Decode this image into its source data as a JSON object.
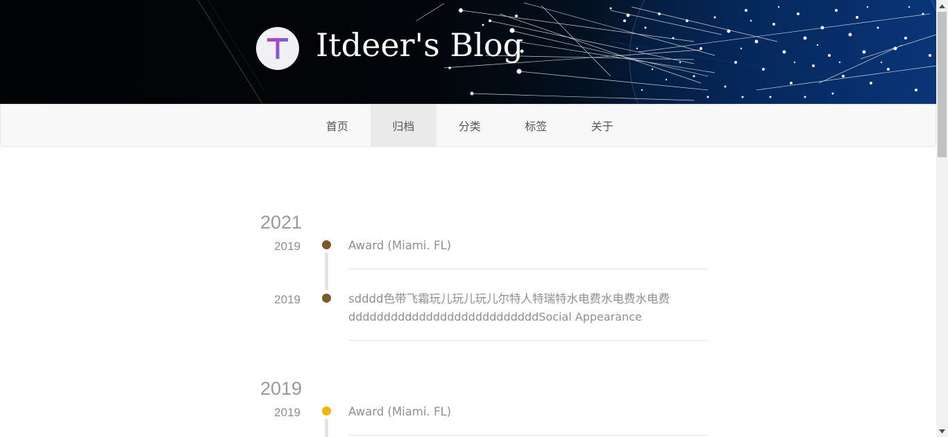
{
  "header": {
    "site_title": "Itdeer's Blog",
    "avatar_letter": "T"
  },
  "nav": {
    "items": [
      {
        "label": "首页",
        "active": false
      },
      {
        "label": "归档",
        "active": true
      },
      {
        "label": "分类",
        "active": false
      },
      {
        "label": "标签",
        "active": false
      },
      {
        "label": "关于",
        "active": false
      }
    ]
  },
  "archive": {
    "groups": [
      {
        "year": "2021",
        "posts": [
          {
            "date": "2019",
            "title": "Award (Miami. FL)",
            "dot_color": "#7d5928"
          },
          {
            "date": "2019",
            "title": "sdddd色带飞霜玩儿玩儿玩儿尔特人特瑞特水电费水电费水电费",
            "title_cont": "dddddddddddddddddddddddddddSocial Appearance",
            "dot_color": "#7d5928"
          }
        ]
      },
      {
        "year": "2019",
        "posts": [
          {
            "date": "2019",
            "title": "Award (Miami. FL)",
            "dot_color": "#f5b400"
          }
        ]
      }
    ]
  },
  "scrollbar": {
    "up_icon": "scroll-up-arrow-icon",
    "down_icon": "scroll-down-arrow-icon"
  }
}
